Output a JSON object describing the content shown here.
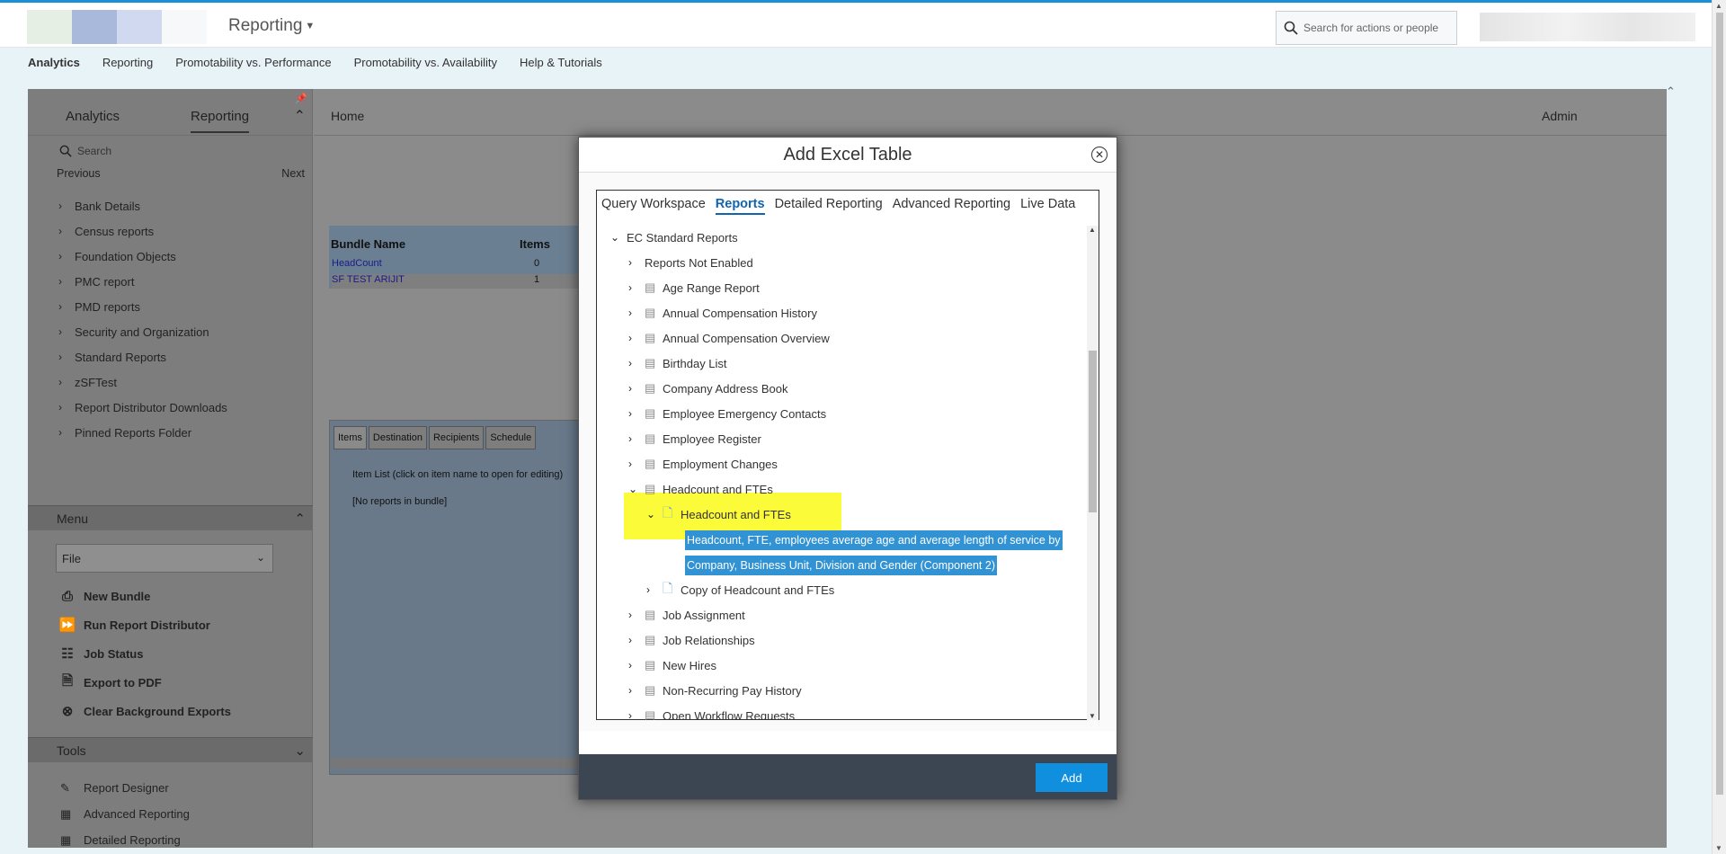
{
  "header": {
    "app_name": "Reporting",
    "search_placeholder": "Search for actions or people"
  },
  "topnav": [
    "Analytics",
    "Reporting",
    "Promotability vs. Performance",
    "Promotability vs. Availability",
    "Help & Tutorials"
  ],
  "sidebar": {
    "tabs": [
      "Analytics",
      "Reporting"
    ],
    "search_placeholder": "Search",
    "previous": "Previous",
    "next": "Next",
    "tree": [
      "Bank Details",
      "Census reports",
      "Foundation Objects",
      "PMC report",
      "PMD reports",
      "Security and Organization",
      "Standard Reports",
      "zSFTest",
      "Report Distributor Downloads",
      "Pinned Reports Folder"
    ],
    "menu_title": "Menu",
    "menu_select": "File",
    "menu_items": [
      "New Bundle",
      "Run Report Distributor",
      "Job Status",
      "Export to PDF",
      "Clear Background Exports"
    ],
    "tools_title": "Tools",
    "tool_items": [
      "Report Designer",
      "Advanced Reporting",
      "Detailed Reporting"
    ]
  },
  "main": {
    "home": "Home",
    "admin": "Admin",
    "bundle_headers": [
      "Bundle Name",
      "Items"
    ],
    "bundles": [
      {
        "name": "HeadCount",
        "items": "0"
      },
      {
        "name": "SF TEST ARIJIT",
        "items": "1"
      }
    ],
    "detail_tabs": [
      "Items",
      "Destination",
      "Recipients",
      "Schedule"
    ],
    "item_list_text": "Item List (click on item name to open for editing)",
    "empty_text": "[No reports in bundle]"
  },
  "modal": {
    "title": "Add Excel Table",
    "tabs": [
      "Query Workspace",
      "Reports",
      "Detailed Reporting",
      "Advanced Reporting",
      "Live Data"
    ],
    "tree": {
      "root": "EC Standard Reports",
      "not_enabled": "Reports Not Enabled",
      "reports": [
        "Age Range Report",
        "Annual Compensation History",
        "Annual Compensation Overview",
        "Birthday List",
        "Company Address Book",
        "Employee Emergency Contacts",
        "Employee Register",
        "Employment Changes"
      ],
      "expanded": "Headcount and FTEs",
      "expanded_child": "Headcount and FTEs",
      "selected_line1": "Headcount, FTE, employees average age and average length of service by",
      "selected_line2": "Company, Business Unit, Division and Gender (Component 2)",
      "copy": "Copy of Headcount and FTEs",
      "after": [
        "Job Assignment",
        "Job Relationships",
        "New Hires",
        "Non-Recurring Pay History",
        "Open Workflow Requests"
      ]
    },
    "add_label": "Add"
  },
  "colors": {
    "accent": "#118fdf",
    "highlight": "#fbfb3a",
    "selection": "#3192d4"
  }
}
